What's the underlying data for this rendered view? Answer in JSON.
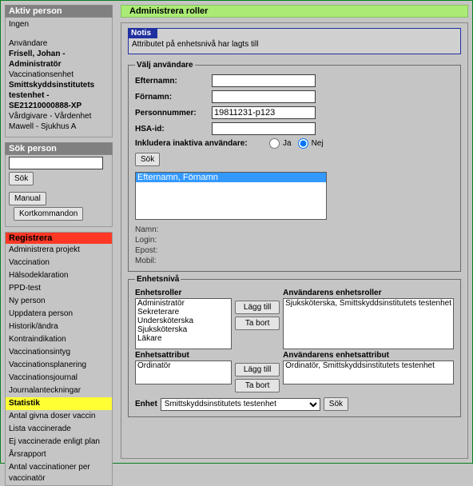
{
  "sidebar": {
    "active_person_header": "Aktiv person",
    "active_person_value": "Ingen",
    "user_label": "Användare",
    "user_name": "Frisell, Johan - Administratör",
    "vacc_unit_label": "Vaccinationsenhet",
    "vacc_unit_value": "Smittskyddsinstitutets testenhet - SE21210000888-XP",
    "care_label": "Vårdgivare - Vårdenhet",
    "care_value": "Mawell - Sjukhus A",
    "search_header": "Sök person",
    "search_btn": "Sök",
    "manual_btn": "Manual",
    "kortkommandon_btn": "Kortkommandon",
    "nav_header": "Registrera",
    "nav": [
      "Administrera projekt",
      "Vaccination",
      "Hälsodeklaration",
      "PPD-test",
      "Ny person",
      "Uppdatera person",
      "Historik/ändra",
      "Kontraindikation",
      "Vaccinationsintyg",
      "Vaccinationsplanering",
      "Vaccinationsjournal",
      "Journalanteckningar",
      "Statistik",
      "Antal givna doser vaccin",
      "Lista vaccinerade",
      "Ej vaccinerade enligt plan",
      "Årsrapport",
      "Antal vaccinationer per vaccinatör"
    ],
    "nav_active_index": 12
  },
  "main": {
    "title": "Administrera roller",
    "notice_header": "Notis",
    "notice_body": "Attributet på enhetsnivå har lagts till",
    "search_legend": "Välj användare",
    "fields": {
      "efternamn": "Efternamn:",
      "fornamn": "Förnamn:",
      "personnummer": "Personnummer:",
      "personnummer_value": "19811231-p123",
      "hsa": "HSA-id:",
      "include_inactive": "Inkludera inaktiva användare:",
      "ja": "Ja",
      "nej": "Nej",
      "sok": "Sök"
    },
    "found_user": "Efternamn, Förnamn",
    "info": {
      "namn": "Namn:",
      "login": "Login:",
      "epost": "Epost:",
      "mobil": "Mobil:"
    },
    "enhet": {
      "legend": "Enhetsnivå",
      "roles_label": "Enhetsroller",
      "roles": [
        "Administratör",
        "Sekreterare",
        "Undersköterska",
        "Sjuksköterska",
        "Läkare"
      ],
      "user_roles_label": "Användarens enhetsroller",
      "user_roles": [
        "Sjuksköterska, Smittskyddsinstitutets testenhet"
      ],
      "attr_label": "Enhetsattribut",
      "attrs": [
        "Ordinatör"
      ],
      "user_attr_label": "Användarens enhetsattribut",
      "user_attrs": [
        "Ordinatör, Smittskyddsinstitutets testenhet"
      ],
      "add": "Lägg till",
      "remove": "Ta bort",
      "enhet_label": "Enhet",
      "enhet_selected": "Smittskyddsinstitutets testenhet",
      "sok": "Sök"
    }
  }
}
